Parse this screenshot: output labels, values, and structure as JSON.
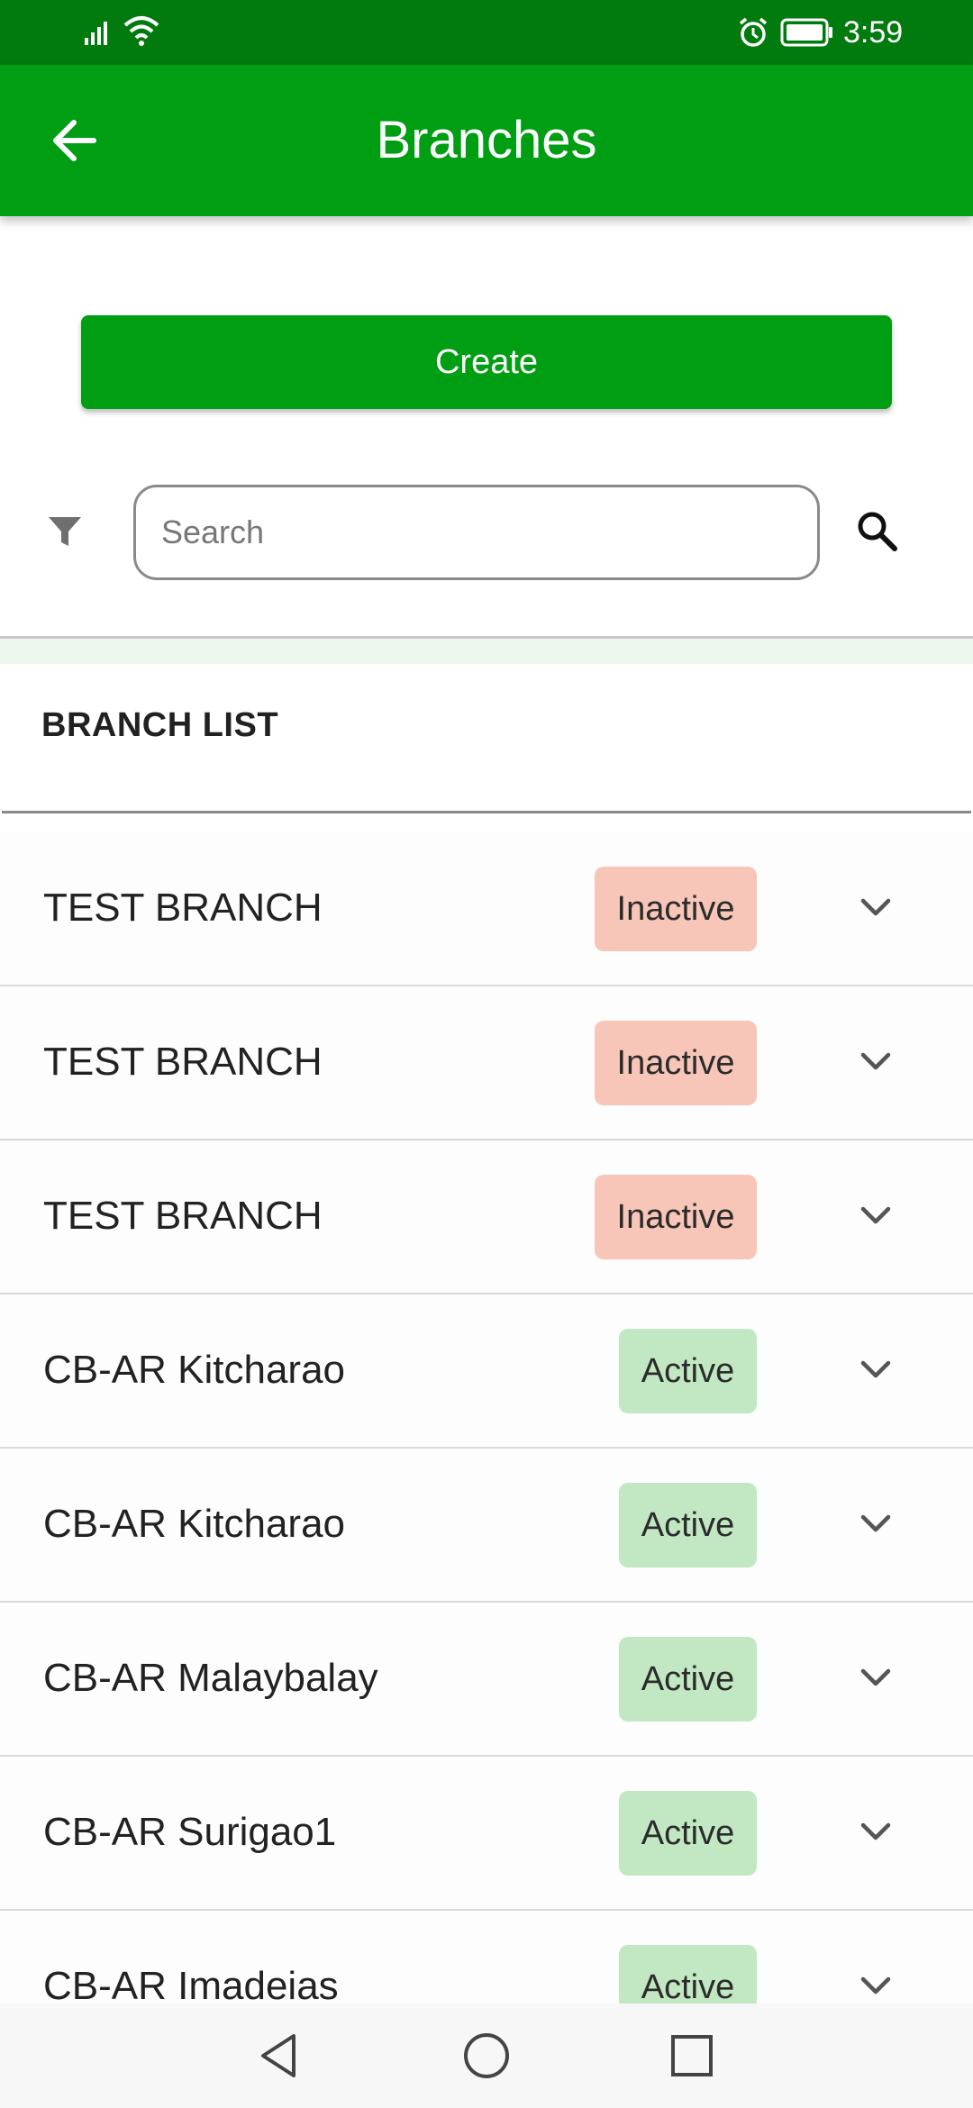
{
  "status_bar": {
    "time": "3:59",
    "icons": [
      "signal-icon",
      "wifi-icon",
      "alarm-icon",
      "battery-icon"
    ]
  },
  "app_bar": {
    "title": "Branches",
    "back_icon": "arrow-left-icon"
  },
  "actions": {
    "create_label": "Create"
  },
  "search": {
    "placeholder": "Search",
    "filter_icon": "filter-icon",
    "search_icon": "search-icon"
  },
  "section": {
    "title": "BRANCH LIST"
  },
  "branches": [
    {
      "name": "TEST BRANCH",
      "status": "Inactive"
    },
    {
      "name": "TEST BRANCH",
      "status": "Inactive"
    },
    {
      "name": "TEST BRANCH",
      "status": "Inactive"
    },
    {
      "name": "CB-AR Kitcharao",
      "status": "Active"
    },
    {
      "name": "CB-AR Kitcharao",
      "status": "Active"
    },
    {
      "name": "CB-AR Malaybalay",
      "status": "Active"
    },
    {
      "name": "CB-AR Surigao1",
      "status": "Active"
    },
    {
      "name": "CB-AR Imadeias",
      "status": "Active"
    }
  ],
  "colors": {
    "status_bar": "#017a0e",
    "primary": "#009e12",
    "inactive_badge": "#f7c6b8",
    "active_badge": "#c2e8c3"
  },
  "nav_bar": {
    "icons": [
      "back-triangle-icon",
      "home-circle-icon",
      "recents-square-icon"
    ]
  }
}
